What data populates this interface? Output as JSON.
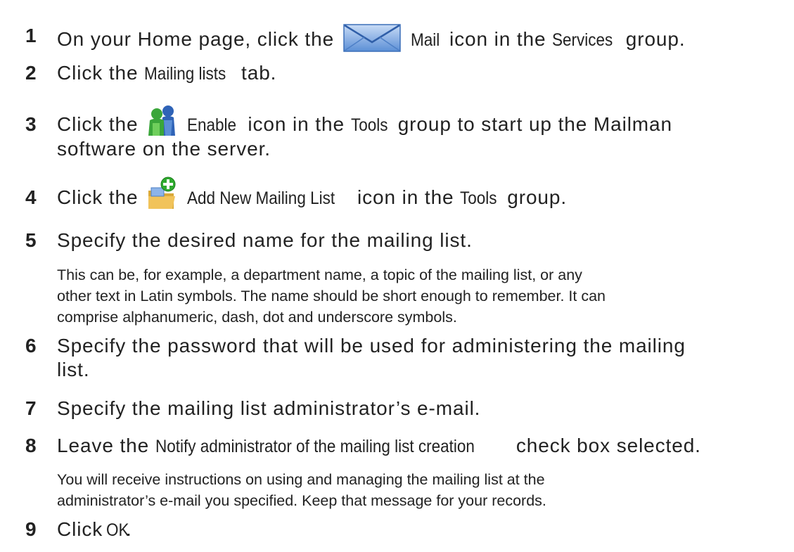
{
  "steps": [
    {
      "number": "1",
      "parts": [
        "On your Home page, click the",
        "Mail",
        "icon in the",
        "Services",
        "group."
      ],
      "icon": "mail-envelope-icon"
    },
    {
      "number": "2",
      "parts": [
        "Click the",
        "Mailing lists",
        "tab."
      ]
    },
    {
      "number": "3",
      "parts": [
        "Click the",
        "Enable",
        "icon in the",
        "Tools",
        "group to start up the Mailman",
        "software on the server."
      ],
      "icon": "enable-mailman-icon"
    },
    {
      "number": "4",
      "parts": [
        "Click the",
        "Add New Mailing List",
        "icon in the",
        "Tools",
        "group."
      ],
      "icon": "add-mailing-list-icon"
    },
    {
      "number": "5",
      "parts": [
        "Specify the desired name for the mailing list."
      ],
      "note": [
        "This can be, for example, a department name, a topic of the mailing list, or any",
        "other text in Latin symbols. The name should be short enough to remember. It can",
        "comprise alphanumeric, dash, dot and underscore symbols."
      ]
    },
    {
      "number": "6",
      "parts": [
        "Specify the password that will be used for administering the mailing",
        "list."
      ]
    },
    {
      "number": "7",
      "parts": [
        "Specify the mailing list administrator’s e-mail."
      ]
    },
    {
      "number": "8",
      "parts": [
        "Leave the",
        "Notify administrator of the mailing list creation",
        "check box selected."
      ],
      "note": [
        "You will receive instructions on using and managing the mailing list at the",
        "administrator’s e-mail you specified. Keep that message for your records."
      ]
    },
    {
      "number": "9",
      "parts": [
        "Click",
        "OK",
        "."
      ]
    }
  ],
  "colors": {
    "text": "#222222",
    "mail_icon_blue": "#5b8fd6",
    "enable_icon_green": "#3aa63a",
    "enable_icon_blue": "#2f63b7",
    "add_icon_green": "#2eaa2e",
    "folder_yellow": "#f1c35a"
  }
}
